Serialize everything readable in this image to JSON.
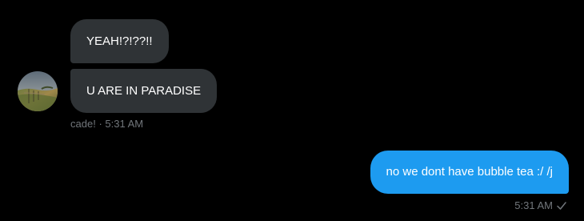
{
  "incoming": {
    "messages": [
      {
        "text": "YEAH!?!??!!"
      },
      {
        "text": "U ARE IN PARADISE"
      }
    ],
    "sender": "cade!",
    "separator": "·",
    "time": "5:31 AM"
  },
  "outgoing": {
    "message": "no we dont have bubble tea :/ /j",
    "time": "5:31 AM",
    "status_icon": "check-icon"
  },
  "colors": {
    "background": "#000000",
    "incoming_bubble": "#2f3336",
    "outgoing_bubble": "#1d9bf0",
    "meta_text": "#71767b"
  }
}
